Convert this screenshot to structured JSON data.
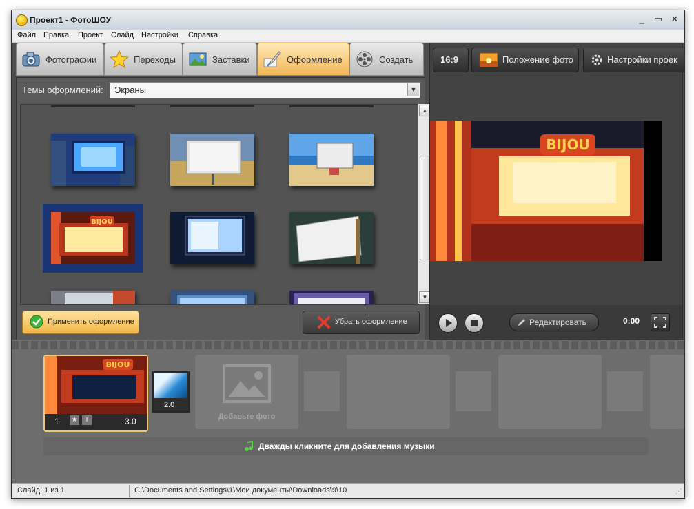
{
  "window": {
    "title": "Проект1 - ФотоШОУ",
    "controls": [
      "_",
      "▭",
      "✕"
    ]
  },
  "menu": [
    "Файл",
    "Правка",
    "Проект",
    "Слайд",
    "Настройки",
    "Справка"
  ],
  "tabs": [
    {
      "label": "Фотографии",
      "icon": "camera-icon"
    },
    {
      "label": "Переходы",
      "icon": "star-icon"
    },
    {
      "label": "Заставки",
      "icon": "landscape-icon"
    },
    {
      "label": "Оформление",
      "icon": "brush-icon",
      "active": true
    },
    {
      "label": "Создать",
      "icon": "film-reel-icon"
    }
  ],
  "themes": {
    "label": "Темы оформлений:",
    "selected": "Экраны",
    "thumbnails": [
      {
        "name": "city-billboard",
        "selected": false
      },
      {
        "name": "field-billboard",
        "selected": false
      },
      {
        "name": "beach-billboard",
        "selected": false
      },
      {
        "name": "bijou-marquee",
        "selected": true
      },
      {
        "name": "tv-screen",
        "selected": false
      },
      {
        "name": "easel-canvas",
        "selected": false
      }
    ]
  },
  "buttons": {
    "apply": "Применить оформление",
    "remove": "Убрать оформление"
  },
  "preview_toolbar": {
    "ratio": "16:9",
    "photo_position": "Положение фото",
    "project_settings": "Настройки проек"
  },
  "preview": {
    "sign_text": "BIJOU"
  },
  "player": {
    "edit": "Редактировать",
    "time": "0:00"
  },
  "timeline": {
    "slide": {
      "number": "1",
      "duration": "3.0",
      "sign_text": "BIJOU"
    },
    "transition": {
      "duration": "2.0"
    },
    "add_photo": "Добавьте фото",
    "music": "Дважды кликните для добавления музыки"
  },
  "status": {
    "slide": "Слайд: 1 из 1",
    "path": "C:\\Documents and Settings\\1\\Мои документы\\Downloads\\9\\10"
  },
  "colors": {
    "accent": "#f2b657",
    "panel": "#4d4d4d",
    "selection": "#1a3576"
  }
}
